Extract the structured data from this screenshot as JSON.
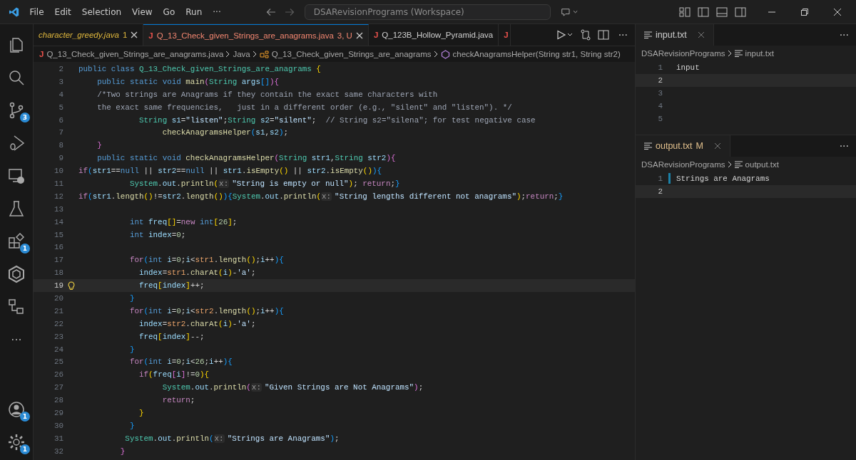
{
  "title_bar": {
    "menus": [
      "File",
      "Edit",
      "Selection",
      "View",
      "Go",
      "Run",
      "···"
    ],
    "command_center": "DSARevisionPrograms (Workspace)"
  },
  "activity_bar": {
    "top": [
      {
        "kind": "files"
      },
      {
        "kind": "search"
      },
      {
        "kind": "source-control",
        "badge": "3"
      },
      {
        "kind": "debug"
      },
      {
        "kind": "remote"
      },
      {
        "kind": "flask"
      },
      {
        "kind": "extensions",
        "badge": "1"
      },
      {
        "kind": "hexagon"
      },
      {
        "kind": "tree"
      },
      {
        "kind": "more",
        "text": "···"
      }
    ],
    "bottom": [
      {
        "kind": "account",
        "badge": "1"
      },
      {
        "kind": "gear",
        "badge": "1"
      }
    ]
  },
  "editor": {
    "tabs": [
      {
        "label": "character_greedy.java",
        "badge": "1",
        "preview": true,
        "color": "#e2b93d",
        "selected": false,
        "close": true
      },
      {
        "icon": "J",
        "label": "Q_13_Check_given_Strings_are_anagrams.java",
        "badge": "3, U",
        "preview": false,
        "color": "#f48771",
        "selected": true,
        "close": true
      },
      {
        "icon": "J",
        "label": "Q_123B_Hollow_Pyramid.java",
        "preview": false,
        "selected": false,
        "close": false
      },
      {
        "icon": "J",
        "selected": false,
        "close": false
      }
    ],
    "more": "···",
    "breadcrumb": [
      {
        "kind": "java",
        "icon": "J",
        "text": "Q_13_Check_given_Strings_are_anagrams.java"
      },
      {
        "kind": "plain",
        "text": "Java"
      },
      {
        "kind": "class",
        "text": "Q_13_Check_given_Strings_are_anagrams"
      },
      {
        "kind": "method",
        "text": "checkAnagramsHelper(String str1, String str2)"
      }
    ],
    "lines": [
      {
        "number": "2",
        "current": false,
        "tokens": [
          {
            "kind": "kw",
            "text": "public class "
          },
          {
            "kind": "type",
            "text": "Q_13_Check_given_Strings_are_anagrams "
          },
          {
            "kind": "y",
            "text": "{"
          }
        ]
      },
      {
        "number": "3",
        "current": false,
        "tokens": [
          {
            "kind": "kw",
            "text": "    public static void "
          },
          {
            "kind": "fn",
            "text": "main"
          },
          {
            "kind": "p",
            "text": "("
          },
          {
            "kind": "type",
            "text": "String "
          },
          {
            "kind": "var",
            "text": "args"
          },
          {
            "kind": "b",
            "text": "[]"
          },
          {
            "kind": "p",
            "text": ")"
          },
          {
            "kind": "p",
            "text": "{"
          }
        ]
      },
      {
        "number": "4",
        "current": false,
        "tokens": [
          {
            "kind": "com",
            "text": "    /*Two strings are Anagrams if they contain the exact same characters with"
          }
        ]
      },
      {
        "number": "5",
        "current": false,
        "tokens": [
          {
            "kind": "com",
            "text": "    the exact same frequencies,   just in a different order (e.g., \"silent\" and \"listen\"). */"
          }
        ]
      },
      {
        "number": "6",
        "current": false,
        "tokens": [
          {
            "kind": "type",
            "text": "             String "
          },
          {
            "kind": "var",
            "text": "s1"
          },
          {
            "kind": "txt",
            "text": "="
          },
          {
            "kind": "str",
            "text": "\"listen\""
          },
          {
            "kind": "txt",
            "text": ";"
          },
          {
            "kind": "type",
            "text": "String "
          },
          {
            "kind": "var",
            "text": "s2"
          },
          {
            "kind": "txt",
            "text": "="
          },
          {
            "kind": "str",
            "text": "\"silent\""
          },
          {
            "kind": "txt",
            "text": ";  "
          },
          {
            "kind": "com",
            "text": "// String s2=\"silena\"; for test negative case"
          }
        ]
      },
      {
        "number": "7",
        "current": false,
        "tokens": [
          {
            "kind": "fn",
            "text": "                  checkAnagramsHelper"
          },
          {
            "kind": "b",
            "text": "("
          },
          {
            "kind": "var",
            "text": "s1"
          },
          {
            "kind": "txt",
            "text": ","
          },
          {
            "kind": "var",
            "text": "s2"
          },
          {
            "kind": "b",
            "text": ")"
          },
          {
            "kind": "txt",
            "text": ";"
          }
        ]
      },
      {
        "number": "8",
        "current": false,
        "tokens": [
          {
            "kind": "p",
            "text": "    }"
          }
        ]
      },
      {
        "number": "9",
        "current": false,
        "tokens": [
          {
            "kind": "kw",
            "text": "    public static void "
          },
          {
            "kind": "fn",
            "text": "checkAnagramsHelper"
          },
          {
            "kind": "p",
            "text": "("
          },
          {
            "kind": "type",
            "text": "String "
          },
          {
            "kind": "var",
            "text": "str1"
          },
          {
            "kind": "txt",
            "text": ","
          },
          {
            "kind": "type",
            "text": "String "
          },
          {
            "kind": "var",
            "text": "str2"
          },
          {
            "kind": "p",
            "text": ")"
          },
          {
            "kind": "p",
            "text": "{"
          }
        ]
      },
      {
        "number": "10",
        "current": false,
        "tokens": [
          {
            "kind": "ctl",
            "text": "if"
          },
          {
            "kind": "b",
            "text": "("
          },
          {
            "kind": "var",
            "text": "str1"
          },
          {
            "kind": "txt",
            "text": "=="
          },
          {
            "kind": "kw",
            "text": "null"
          },
          {
            "kind": "txt",
            "text": " || "
          },
          {
            "kind": "var",
            "text": "str2"
          },
          {
            "kind": "txt",
            "text": "=="
          },
          {
            "kind": "kw",
            "text": "null"
          },
          {
            "kind": "txt",
            "text": " || "
          },
          {
            "kind": "var",
            "text": "str1"
          },
          {
            "kind": "txt",
            "text": "."
          },
          {
            "kind": "fn",
            "text": "isEmpty"
          },
          {
            "kind": "y",
            "text": "()"
          },
          {
            "kind": "txt",
            "text": " || "
          },
          {
            "kind": "var",
            "text": "str2"
          },
          {
            "kind": "txt",
            "text": "."
          },
          {
            "kind": "fn",
            "text": "isEmpty"
          },
          {
            "kind": "y",
            "text": "()"
          },
          {
            "kind": "b",
            "text": ")"
          },
          {
            "kind": "b",
            "text": "{"
          }
        ]
      },
      {
        "number": "11",
        "current": false,
        "tokens": [
          {
            "kind": "type",
            "text": "           System"
          },
          {
            "kind": "txt",
            "text": "."
          },
          {
            "kind": "var",
            "text": "out"
          },
          {
            "kind": "txt",
            "text": "."
          },
          {
            "kind": "fn",
            "text": "println"
          },
          {
            "kind": "y",
            "text": "("
          },
          {
            "kind": "hint",
            "text": "x:"
          },
          {
            "kind": "str",
            "text": "\"String is empty or null\""
          },
          {
            "kind": "y",
            "text": ")"
          },
          {
            "kind": "txt",
            "text": "; "
          },
          {
            "kind": "ctl",
            "text": "return"
          },
          {
            "kind": "txt",
            "text": ";"
          },
          {
            "kind": "b",
            "text": "}"
          }
        ]
      },
      {
        "number": "12",
        "current": false,
        "tokens": [
          {
            "kind": "ctl",
            "text": "if"
          },
          {
            "kind": "b",
            "text": "("
          },
          {
            "kind": "var",
            "text": "str1"
          },
          {
            "kind": "txt",
            "text": "."
          },
          {
            "kind": "fn",
            "text": "length"
          },
          {
            "kind": "y",
            "text": "()"
          },
          {
            "kind": "txt",
            "text": "!="
          },
          {
            "kind": "var",
            "text": "str2"
          },
          {
            "kind": "txt",
            "text": "."
          },
          {
            "kind": "fn",
            "text": "length"
          },
          {
            "kind": "y",
            "text": "()"
          },
          {
            "kind": "b",
            "text": ")"
          },
          {
            "kind": "b",
            "text": "{"
          },
          {
            "kind": "type",
            "text": "System"
          },
          {
            "kind": "txt",
            "text": "."
          },
          {
            "kind": "var",
            "text": "out"
          },
          {
            "kind": "txt",
            "text": "."
          },
          {
            "kind": "fn",
            "text": "println"
          },
          {
            "kind": "y",
            "text": "("
          },
          {
            "kind": "hint",
            "text": "x:"
          },
          {
            "kind": "str",
            "text": "\"String lengths different not anagrams\""
          },
          {
            "kind": "y",
            "text": ")"
          },
          {
            "kind": "txt",
            "text": ";"
          },
          {
            "kind": "ctl",
            "text": "return"
          },
          {
            "kind": "txt",
            "text": ";"
          },
          {
            "kind": "b",
            "text": "}"
          }
        ]
      },
      {
        "number": "13",
        "current": false
      },
      {
        "number": "14",
        "current": false,
        "tokens": [
          {
            "kind": "kw",
            "text": "           int "
          },
          {
            "kind": "var",
            "text": "freq"
          },
          {
            "kind": "y",
            "text": "[]"
          },
          {
            "kind": "txt",
            "text": "="
          },
          {
            "kind": "ctl",
            "text": "new "
          },
          {
            "kind": "kw",
            "text": "int"
          },
          {
            "kind": "y",
            "text": "["
          },
          {
            "kind": "num",
            "text": "26"
          },
          {
            "kind": "y",
            "text": "]"
          },
          {
            "kind": "txt",
            "text": ";"
          }
        ]
      },
      {
        "number": "15",
        "current": false,
        "tokens": [
          {
            "kind": "kw",
            "text": "           int "
          },
          {
            "kind": "var",
            "text": "index"
          },
          {
            "kind": "txt",
            "text": "="
          },
          {
            "kind": "num",
            "text": "0"
          },
          {
            "kind": "txt",
            "text": ";"
          }
        ]
      },
      {
        "number": "16",
        "current": false
      },
      {
        "number": "17",
        "current": false,
        "tokens": [
          {
            "kind": "ctl",
            "text": "           for"
          },
          {
            "kind": "b",
            "text": "("
          },
          {
            "kind": "kw",
            "text": "int "
          },
          {
            "kind": "var",
            "text": "i"
          },
          {
            "kind": "txt",
            "text": "="
          },
          {
            "kind": "num",
            "text": "0"
          },
          {
            "kind": "txt",
            "text": ";"
          },
          {
            "kind": "var",
            "text": "i"
          },
          {
            "kind": "txt",
            "text": "<"
          },
          {
            "kind": "param",
            "text": "str1"
          },
          {
            "kind": "txt",
            "text": "."
          },
          {
            "kind": "fn",
            "text": "length"
          },
          {
            "kind": "y",
            "text": "()"
          },
          {
            "kind": "txt",
            "text": ";"
          },
          {
            "kind": "var",
            "text": "i"
          },
          {
            "kind": "txt",
            "text": "++"
          },
          {
            "kind": "b",
            "text": ")"
          },
          {
            "kind": "b",
            "text": "{"
          }
        ]
      },
      {
        "number": "18",
        "current": false,
        "tokens": [
          {
            "kind": "var",
            "text": "             index"
          },
          {
            "kind": "txt",
            "text": "="
          },
          {
            "kind": "param",
            "text": "str1"
          },
          {
            "kind": "txt",
            "text": "."
          },
          {
            "kind": "fn",
            "text": "charAt"
          },
          {
            "kind": "y",
            "text": "("
          },
          {
            "kind": "var",
            "text": "i"
          },
          {
            "kind": "y",
            "text": ")"
          },
          {
            "kind": "txt",
            "text": "-"
          },
          {
            "kind": "str",
            "text": "'a'"
          },
          {
            "kind": "txt",
            "text": ";"
          }
        ]
      },
      {
        "number": "19",
        "current": true,
        "tokens": [
          {
            "kind": "var",
            "text": "             freq"
          },
          {
            "kind": "y",
            "text": "["
          },
          {
            "kind": "var",
            "text": "index"
          },
          {
            "kind": "y",
            "text": "]"
          },
          {
            "kind": "txt",
            "text": "++;"
          }
        ]
      },
      {
        "number": "20",
        "current": false,
        "tokens": [
          {
            "kind": "b",
            "text": "           }"
          }
        ]
      },
      {
        "number": "21",
        "current": false,
        "tokens": [
          {
            "kind": "ctl",
            "text": "           for"
          },
          {
            "kind": "b",
            "text": "("
          },
          {
            "kind": "kw",
            "text": "int "
          },
          {
            "kind": "var",
            "text": "i"
          },
          {
            "kind": "txt",
            "text": "="
          },
          {
            "kind": "num",
            "text": "0"
          },
          {
            "kind": "txt",
            "text": ";"
          },
          {
            "kind": "var",
            "text": "i"
          },
          {
            "kind": "txt",
            "text": "<"
          },
          {
            "kind": "param",
            "text": "str2"
          },
          {
            "kind": "txt",
            "text": "."
          },
          {
            "kind": "fn",
            "text": "length"
          },
          {
            "kind": "y",
            "text": "()"
          },
          {
            "kind": "txt",
            "text": ";"
          },
          {
            "kind": "var",
            "text": "i"
          },
          {
            "kind": "txt",
            "text": "++"
          },
          {
            "kind": "b",
            "text": ")"
          },
          {
            "kind": "b",
            "text": "{"
          }
        ]
      },
      {
        "number": "22",
        "current": false,
        "tokens": [
          {
            "kind": "var",
            "text": "             index"
          },
          {
            "kind": "txt",
            "text": "="
          },
          {
            "kind": "param",
            "text": "str2"
          },
          {
            "kind": "txt",
            "text": "."
          },
          {
            "kind": "fn",
            "text": "charAt"
          },
          {
            "kind": "y",
            "text": "("
          },
          {
            "kind": "var",
            "text": "i"
          },
          {
            "kind": "y",
            "text": ")"
          },
          {
            "kind": "txt",
            "text": "-"
          },
          {
            "kind": "str",
            "text": "'a'"
          },
          {
            "kind": "txt",
            "text": ";"
          }
        ]
      },
      {
        "number": "23",
        "current": false,
        "tokens": [
          {
            "kind": "var",
            "text": "             freq"
          },
          {
            "kind": "y",
            "text": "["
          },
          {
            "kind": "var",
            "text": "index"
          },
          {
            "kind": "y",
            "text": "]"
          },
          {
            "kind": "txt",
            "text": "--;"
          }
        ]
      },
      {
        "number": "24",
        "current": false,
        "tokens": [
          {
            "kind": "b",
            "text": "           }"
          }
        ]
      },
      {
        "number": "25",
        "current": false,
        "tokens": [
          {
            "kind": "ctl",
            "text": "           for"
          },
          {
            "kind": "b",
            "text": "("
          },
          {
            "kind": "kw",
            "text": "int "
          },
          {
            "kind": "var",
            "text": "i"
          },
          {
            "kind": "txt",
            "text": "="
          },
          {
            "kind": "num",
            "text": "0"
          },
          {
            "kind": "txt",
            "text": ";"
          },
          {
            "kind": "var",
            "text": "i"
          },
          {
            "kind": "txt",
            "text": "<"
          },
          {
            "kind": "num",
            "text": "26"
          },
          {
            "kind": "txt",
            "text": ";"
          },
          {
            "kind": "var",
            "text": "i"
          },
          {
            "kind": "txt",
            "text": "++"
          },
          {
            "kind": "b",
            "text": ")"
          },
          {
            "kind": "b",
            "text": "{"
          }
        ]
      },
      {
        "number": "26",
        "current": false,
        "tokens": [
          {
            "kind": "ctl",
            "text": "             if"
          },
          {
            "kind": "y",
            "text": "("
          },
          {
            "kind": "var",
            "text": "freq"
          },
          {
            "kind": "p",
            "text": "["
          },
          {
            "kind": "var",
            "text": "i"
          },
          {
            "kind": "p",
            "text": "]"
          },
          {
            "kind": "txt",
            "text": "!="
          },
          {
            "kind": "num",
            "text": "0"
          },
          {
            "kind": "y",
            "text": ")"
          },
          {
            "kind": "y",
            "text": "{"
          }
        ]
      },
      {
        "number": "27",
        "current": false,
        "tokens": [
          {
            "kind": "type",
            "text": "                  System"
          },
          {
            "kind": "txt",
            "text": "."
          },
          {
            "kind": "var",
            "text": "out"
          },
          {
            "kind": "txt",
            "text": "."
          },
          {
            "kind": "fn",
            "text": "println"
          },
          {
            "kind": "p",
            "text": "("
          },
          {
            "kind": "hint",
            "text": "x:"
          },
          {
            "kind": "str",
            "text": "\"Given Strings are Not Anagrams\""
          },
          {
            "kind": "p",
            "text": ")"
          },
          {
            "kind": "txt",
            "text": ";"
          }
        ]
      },
      {
        "number": "28",
        "current": false,
        "tokens": [
          {
            "kind": "ctl",
            "text": "                  return"
          },
          {
            "kind": "txt",
            "text": ";"
          }
        ]
      },
      {
        "number": "29",
        "current": false,
        "tokens": [
          {
            "kind": "y",
            "text": "             }"
          }
        ]
      },
      {
        "number": "30",
        "current": false,
        "tokens": [
          {
            "kind": "b",
            "text": "           }"
          }
        ]
      },
      {
        "number": "31",
        "current": false,
        "tokens": [
          {
            "kind": "type",
            "text": "          System"
          },
          {
            "kind": "txt",
            "text": "."
          },
          {
            "kind": "var",
            "text": "out"
          },
          {
            "kind": "txt",
            "text": "."
          },
          {
            "kind": "fn",
            "text": "println"
          },
          {
            "kind": "b",
            "text": "("
          },
          {
            "kind": "hint",
            "text": "x:"
          },
          {
            "kind": "str",
            "text": "\"Strings are Anagrams\""
          },
          {
            "kind": "b",
            "text": ")"
          },
          {
            "kind": "txt",
            "text": ";"
          }
        ]
      },
      {
        "number": "32",
        "current": false,
        "tokens": [
          {
            "kind": "p",
            "text": "         }"
          }
        ]
      }
    ]
  },
  "side_groups": [
    {
      "tab": {
        "label": "input.txt",
        "close": true
      },
      "more": "···",
      "breadcrumb": [
        "DSARevisionPrograms",
        "input.txt"
      ],
      "lines": [
        {
          "number": "1",
          "text": "input",
          "current": false,
          "changed": false
        },
        {
          "number": "2",
          "current": true,
          "changed": false
        },
        {
          "number": "3",
          "current": false,
          "changed": false
        },
        {
          "number": "4",
          "current": false,
          "changed": false
        },
        {
          "number": "5",
          "current": false,
          "changed": false
        }
      ]
    },
    {
      "tab": {
        "label": "output.txt",
        "modified": "M",
        "close": true
      },
      "more": "···",
      "breadcrumb": [
        "DSARevisionPrograms",
        "output.txt"
      ],
      "lines": [
        {
          "number": "1",
          "text": "Strings are Anagrams",
          "current": false,
          "changed": true
        },
        {
          "number": "2",
          "current": true,
          "changed": false
        }
      ]
    }
  ]
}
